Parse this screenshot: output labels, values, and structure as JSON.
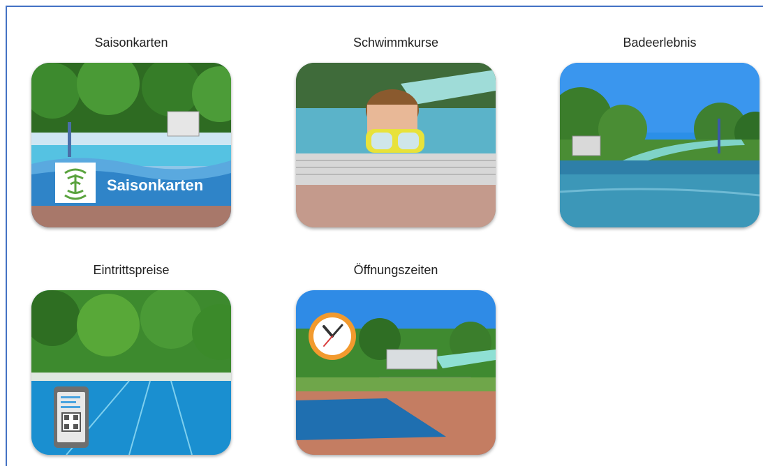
{
  "tiles": [
    {
      "id": "saisonkarten",
      "caption": "Saisonkarten",
      "overlay": "Saisonkarten"
    },
    {
      "id": "schwimmkurse",
      "caption": "Schwimmkurse"
    },
    {
      "id": "badeerlebnis",
      "caption": "Badeerlebnis"
    },
    {
      "id": "eintrittspreise",
      "caption": "Eintrittspreise"
    },
    {
      "id": "oeffnungszeiten",
      "caption": "Öffnungszeiten"
    }
  ],
  "colors": {
    "frame": "#4472c4",
    "pool": "#2ea3d6",
    "sky": "#3a8fe8",
    "trees": "#2f7d2a"
  }
}
